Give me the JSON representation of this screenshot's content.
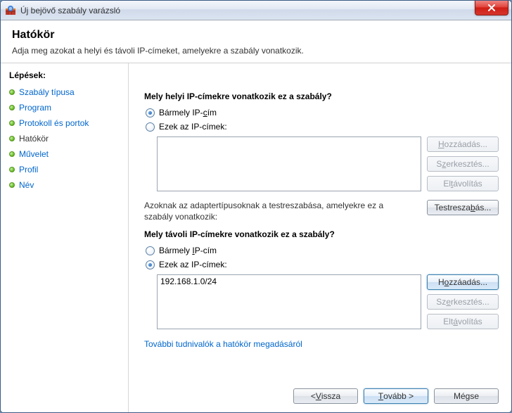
{
  "window": {
    "title": "Új bejövő szabály varázsló"
  },
  "close": {
    "label": "X"
  },
  "header": {
    "title": "Hatókör",
    "subtitle": "Adja meg azokat a helyi és távoli IP-címeket, amelyekre a szabály vonatkozik."
  },
  "sidebar": {
    "steps_title": "Lépések:",
    "items": [
      {
        "label": "Szabály típusa",
        "link": true
      },
      {
        "label": "Program",
        "link": true
      },
      {
        "label": "Protokoll és portok",
        "link": true
      },
      {
        "label": "Hatókör",
        "link": false
      },
      {
        "label": "Művelet",
        "link": true
      },
      {
        "label": "Profil",
        "link": true
      },
      {
        "label": "Név",
        "link": true
      }
    ]
  },
  "local": {
    "question": "Mely helyi IP-címekre vonatkozik ez a szabály?",
    "opt_any_pre": "Bármely IP-",
    "opt_any_u": "c",
    "opt_any_post": "ím",
    "opt_these": "Ezek az IP-címek:",
    "buttons": {
      "add_pre": "",
      "add_u": "H",
      "add_post": "ozzáadás...",
      "edit_pre": "S",
      "edit_u": "z",
      "edit_post": "erkesztés...",
      "remove_pre": "El",
      "remove_u": "t",
      "remove_post": "ávolítás"
    }
  },
  "adapter": {
    "text": "Azoknak az adaptertípusoknak a testreszabása, amelyekre ez a szabály vonatkozik:",
    "btn_pre": "Testresza",
    "btn_u": "b",
    "btn_post": "ás..."
  },
  "remote": {
    "question": "Mely távoli IP-címekre vonatkozik ez a szabály?",
    "opt_any_pre": "Bármely ",
    "opt_any_u": "I",
    "opt_any_post": "P-cím",
    "opt_these": "Ezek az IP-címek:",
    "list_item": "192.168.1.0/24",
    "buttons": {
      "add_pre": "H",
      "add_u": "o",
      "add_post": "zzáadás...",
      "edit_pre": "Sz",
      "edit_u": "e",
      "edit_post": "rkesztés...",
      "remove_pre": "Elt",
      "remove_u": "á",
      "remove_post": "volítás"
    }
  },
  "more_info": "További tudnivalók a hatókör megadásáról",
  "footer": {
    "back_pre": "< ",
    "back_u": "V",
    "back_post": "issza",
    "next_pre": "",
    "next_u": "T",
    "next_post": "ovább >",
    "cancel": "Mégse"
  }
}
